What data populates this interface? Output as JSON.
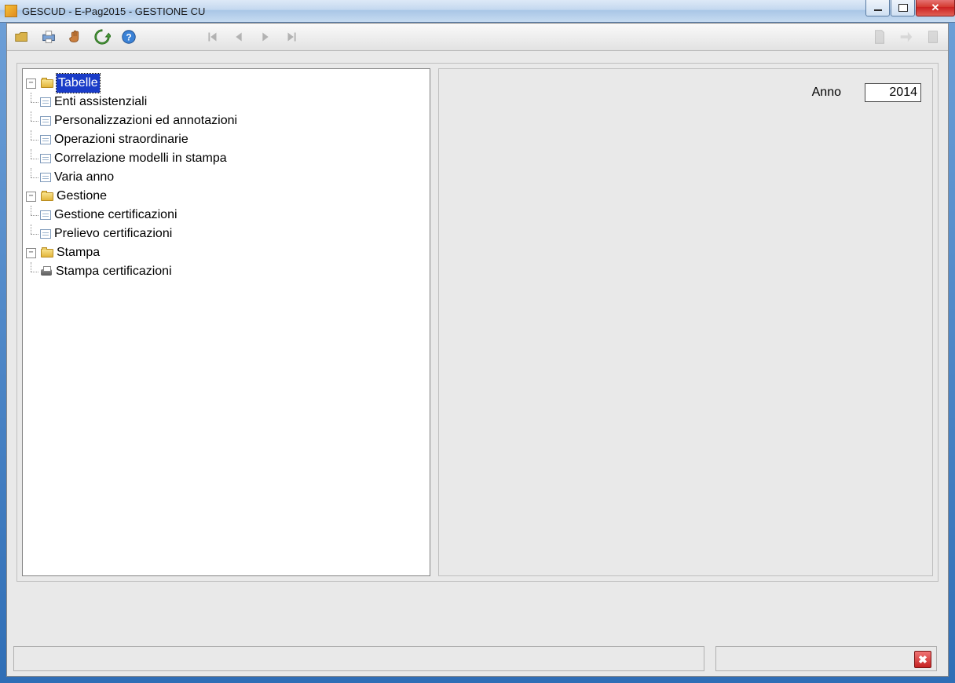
{
  "window": {
    "title": "GESCUD  - E-Pag2015  -  GESTIONE CU"
  },
  "toolbar": {
    "open": "open",
    "print": "print",
    "copy": "copy",
    "refresh": "refresh",
    "help": "help",
    "nav_first": "first",
    "nav_prev": "prev",
    "nav_next": "next",
    "nav_last": "last",
    "doc1": "doc",
    "doc2": "doc",
    "doc3": "doc"
  },
  "tree": {
    "nodes": [
      {
        "label": "Tabelle",
        "selected": true,
        "children": [
          {
            "label": "Enti assistenziali"
          },
          {
            "label": "Personalizzazioni ed annotazioni"
          },
          {
            "label": "Operazioni straordinarie"
          },
          {
            "label": "Correlazione modelli in stampa"
          },
          {
            "label": "Varia anno"
          }
        ]
      },
      {
        "label": "Gestione",
        "children": [
          {
            "label": "Gestione certificazioni"
          },
          {
            "label": "Prelievo certificazioni"
          }
        ]
      },
      {
        "label": "Stampa",
        "children": [
          {
            "label": "Stampa certificazioni",
            "icon": "print"
          }
        ]
      }
    ]
  },
  "side": {
    "anno_label": "Anno",
    "anno_value": "2014"
  }
}
